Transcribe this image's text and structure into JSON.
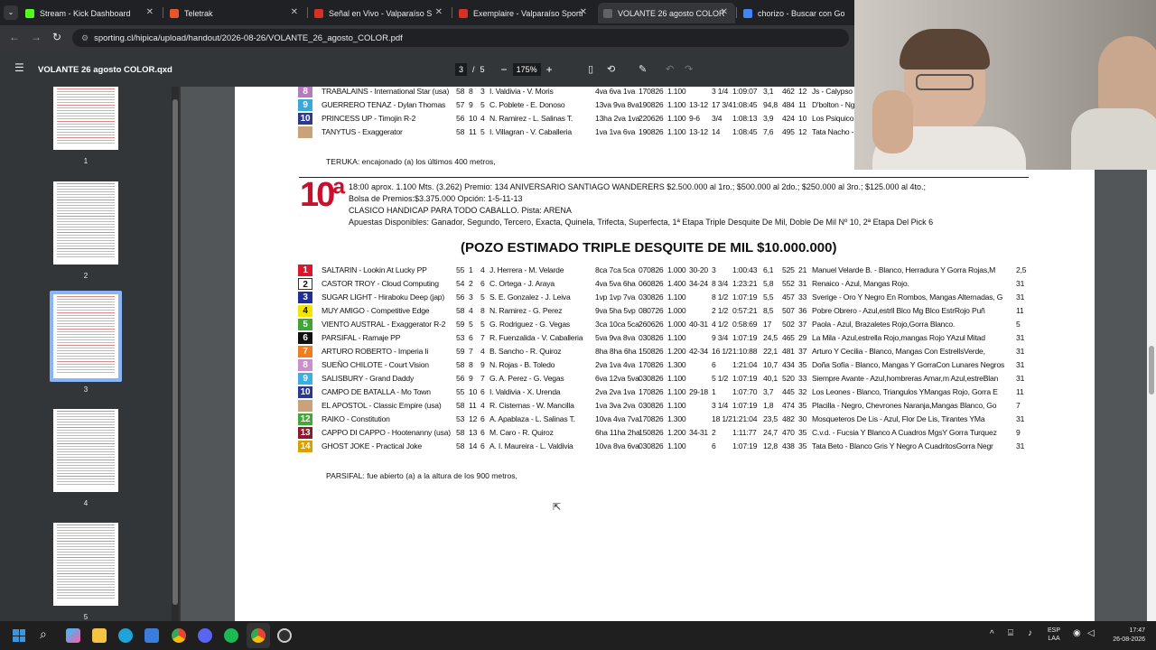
{
  "browser": {
    "tabs": [
      {
        "title": "Stream - Kick Dashboard",
        "active": false,
        "color": "#53fc18"
      },
      {
        "title": "Teletrak",
        "active": false,
        "color": "#e8552b"
      },
      {
        "title": "Señal en Vivo - Valparaíso S",
        "active": false,
        "color": "#d93025"
      },
      {
        "title": "Exemplaire - Valparaíso Sportin",
        "active": false,
        "color": "#d93025"
      },
      {
        "title": "VOLANTE 26 agosto COLOR.qx",
        "active": true,
        "color": "#5f6368"
      },
      {
        "title": "chorizo - Buscar con Google",
        "active": false,
        "color": "#4285f4"
      }
    ],
    "url": "sporting.cl/hipica/upload/handout/2026-08-26/VOLANTE_26_agosto_COLOR.pdf"
  },
  "pdf": {
    "title": "VOLANTE 26 agosto COLOR.qxd",
    "current_page": "3",
    "total_pages": "5",
    "zoom": "175%",
    "thumbnails": [
      "1",
      "2",
      "3",
      "4",
      "5"
    ],
    "selected_thumbnail": "3"
  },
  "prev_race": {
    "rows": [
      {
        "n": "8",
        "c": "#b57bbd",
        "horse": "TRABALAINS - International Star (usa)",
        "w": "58",
        "p": "8",
        "s": "3",
        "jt": "I. Valdivia - V. Moris",
        "form": "4va 6va 1va",
        "date": "170826",
        "dist": "1.100",
        "h": "",
        "m": "3 1/4",
        "time": "1:09:07",
        "a": "3,1",
        "b": "462",
        "d": "12",
        "own": "Js - Calypso"
      },
      {
        "n": "9",
        "c": "#3aa8d8",
        "horse": "GUERRERO TENAZ - Dylan Thomas",
        "w": "57",
        "p": "9",
        "s": "5",
        "jt": "C. Poblete - E. Donoso",
        "form": "13va 9va 8va",
        "date": "190826",
        "dist": "1.100",
        "h": "13-12",
        "m": "17 3/4",
        "time": "1:08:45",
        "a": "94,8",
        "b": "484",
        "d": "11",
        "own": "D'bolton - Ng"
      },
      {
        "n": "10",
        "c": "#2d3a8c",
        "horse": "PRINCESS UP - Timojin R-2",
        "w": "56",
        "p": "10",
        "s": "4",
        "jt": "N. Ramirez - L. Salinas T.",
        "form": "13ha 2va 1va",
        "date": "220626",
        "dist": "1.100",
        "h": "9-6",
        "m": "3/4",
        "time": "1:08:13",
        "a": "3,9",
        "b": "424",
        "d": "10",
        "own": "Los Psiquico"
      },
      {
        "n": "",
        "c": "#c9a27a",
        "horse": "TANYTUS - Exaggerator",
        "w": "58",
        "p": "11",
        "s": "5",
        "jt": "I. Villagran - V. Caballeria",
        "form": "1va 1va 6va",
        "date": "190826",
        "dist": "1.100",
        "h": "13-12",
        "m": "14",
        "time": "1:08:45",
        "a": "7,6",
        "b": "495",
        "d": "12",
        "own": "Tata Nacho -"
      }
    ],
    "note": "TERUKA: encajonado (a) los últimos   400 metros,"
  },
  "race": {
    "number": "10ª",
    "line1": "18:00 aprox. 1.100 Mts. (3.262)   Premio: 134 ANIVERSARIO SANTIAGO WANDERERS    $2.500.000 al 1ro.; $500.000 al 2do.; $250.000 al 3ro.; $125.000 al 4to.;",
    "line2": "Bolsa de Premios:$3.375.000    Opción: 1-5-11-13",
    "line3": "CLASICO HANDICAP  PARA TODO CABALLO.    Pista: ARENA",
    "line4": "Apuestas Disponibles: Ganador, Segundo, Tercero, Exacta, Quinela, Trifecta, Superfecta, 1ª Etapa Triple Desquite De Mil, Doble De Mil Nº 10, 2ª Etapa Del Pick 6",
    "pozo": "(POZO ESTIMADO TRIPLE DESQUITE DE MIL  $10.000.000)",
    "rows": [
      {
        "n": "1",
        "c": "#d7192b",
        "horse": "SALTARIN - Lookin At Lucky  PP",
        "w": "55",
        "p": "1",
        "s": "4",
        "jt": "J. Herrera - M. Velarde",
        "form": "8ca 7ca 5ca",
        "date": "070826",
        "dist": "1.000",
        "h": "30-20",
        "m": "3",
        "time": "1:00:43",
        "a": "6,1",
        "b": "525",
        "d": "21",
        "own": "Manuel Velarde B. - Blanco, Herradura Y Gorra Rojas,M",
        "last": "2,5"
      },
      {
        "n": "2",
        "c": "#ffffff",
        "horse": "CASTOR TROY - Cloud Computing",
        "w": "54",
        "p": "2",
        "s": "6",
        "jt": "C. Ortega - J. Araya",
        "form": "4va 5va 6ha",
        "date": "060826",
        "dist": "1.400",
        "h": "34-24",
        "m": "8 3/4",
        "time": "1:23:21",
        "a": "5,8",
        "b": "552",
        "d": "31",
        "own": "Renaico - Azul, Mangas Rojo.",
        "last": "31"
      },
      {
        "n": "3",
        "c": "#1e2f9a",
        "horse": "SUGAR LIGHT - Hiraboku Deep (jap)",
        "w": "56",
        "p": "3",
        "s": "5",
        "jt": "S. E. Gonzalez - J. Leiva",
        "form": "1vp 1vp 7va",
        "date": "030826",
        "dist": "1.100",
        "h": "",
        "m": "8 1/2",
        "time": "1:07:19",
        "a": "5,5",
        "b": "457",
        "d": "33",
        "own": "Sverige - Oro Y Negro En Rombos, Mangas Alternadas, G",
        "last": "31"
      },
      {
        "n": "4",
        "c": "#f2e600",
        "horse": "MUY AMIGO - Competitive Edge",
        "w": "58",
        "p": "4",
        "s": "8",
        "jt": "N. Ramirez - G. Perez",
        "form": "9va 5ha 5vp",
        "date": "080726",
        "dist": "1.000",
        "h": "",
        "m": "2 1/2",
        "time": "0:57:21",
        "a": "8,5",
        "b": "507",
        "d": "36",
        "own": "Pobre Obrero - Azul,estrll Blco Mg Blco EstrRojo Puñ",
        "last": "11"
      },
      {
        "n": "5",
        "c": "#3fa535",
        "horse": "VIENTO AUSTRAL - Exaggerator R-2",
        "w": "59",
        "p": "5",
        "s": "5",
        "jt": "G. Rodriguez - G. Vegas",
        "form": "3ca 10ca 5ca",
        "date": "260626",
        "dist": "1.000",
        "h": "40-31",
        "m": "4 1/2",
        "time": "0:58:69",
        "a": "17",
        "b": "502",
        "d": "37",
        "own": "Paola - Azul, Brazaletes Rojo,Gorra Blanco.",
        "last": "5"
      },
      {
        "n": "6",
        "c": "#111111",
        "horse": "PARSIFAL - Ramaje  PP",
        "w": "53",
        "p": "6",
        "s": "7",
        "jt": "R. Fuenzalida - V. Caballeria",
        "form": "5va 9va 8va",
        "date": "030826",
        "dist": "1.100",
        "h": "",
        "m": "9 3/4",
        "time": "1:07:19",
        "a": "24,5",
        "b": "465",
        "d": "29",
        "own": "La Mila - Azul,estrella Rojo,mangas Rojo YAzul Mitad",
        "last": "31"
      },
      {
        "n": "7",
        "c": "#ee7d22",
        "horse": "ARTURO ROBERTO - Imperia Ii",
        "w": "59",
        "p": "7",
        "s": "4",
        "jt": "B. Sancho - R. Quiroz",
        "form": "8ha 8ha 6ha",
        "date": "150826",
        "dist": "1.200",
        "h": "42-34",
        "m": "16 1/2",
        "time": "1:10:88",
        "a": "22,1",
        "b": "481",
        "d": "37",
        "own": "Arturo Y Cecilia - Blanco, Mangas Con EstrellsVerde,",
        "last": "31"
      },
      {
        "n": "8",
        "c": "#c990c9",
        "horse": "SUEÑO CHILOTE - Court Vision",
        "w": "58",
        "p": "8",
        "s": "9",
        "jt": "N. Rojas - B. Toledo",
        "form": "2va 1va 4va",
        "date": "170826",
        "dist": "1.300",
        "h": "",
        "m": "6",
        "time": "1:21:04",
        "a": "10,7",
        "b": "434",
        "d": "35",
        "own": "Doña Sofía - Blanco, Mangas Y GorraCon Lunares Negros",
        "last": "31"
      },
      {
        "n": "9",
        "c": "#39b0e0",
        "horse": "SALISBURY - Grand Daddy",
        "w": "56",
        "p": "9",
        "s": "7",
        "jt": "G. A. Perez - G. Vegas",
        "form": "6va 12va 5va",
        "date": "030826",
        "dist": "1.100",
        "h": "",
        "m": "5 1/2",
        "time": "1:07:19",
        "a": "40,1",
        "b": "520",
        "d": "33",
        "own": "Siempre Avante - Azul,hombreras Amar,m Azul,estreBlan",
        "last": "31"
      },
      {
        "n": "10",
        "c": "#2a3890",
        "horse": "CAMPO DE BATALLA - Mo Town",
        "w": "55",
        "p": "10",
        "s": "6",
        "jt": "I. Valdivia - X. Urenda",
        "form": "2va 2va 1va",
        "date": "170826",
        "dist": "1.100",
        "h": "29-18",
        "m": "1",
        "time": "1:07:70",
        "a": "3,7",
        "b": "445",
        "d": "32",
        "own": "Los Leones - Blanco, Triangulos YMangas Rojo, Gorra E",
        "last": "11"
      },
      {
        "n": "",
        "c": "#c9a27a",
        "horse": "EL APOSTOL - Classic Empire (usa)",
        "w": "58",
        "p": "11",
        "s": "4",
        "jt": "R. Cisternas - W. Mancilla",
        "form": "1va 3va 2va",
        "date": "030826",
        "dist": "1.100",
        "h": "",
        "m": "3 1/4",
        "time": "1:07:19",
        "a": "1,8",
        "b": "474",
        "d": "35",
        "own": "Placilla - Negro, Chevrones Naranja,Mangas Blanco, Go",
        "last": "7"
      },
      {
        "n": "12",
        "c": "#46a63a",
        "horse": "RAIKO - Constitution",
        "w": "53",
        "p": "12",
        "s": "6",
        "jt": "A. Apablaza - L. Salinas T.",
        "form": "10va 4va 7va",
        "date": "170826",
        "dist": "1.300",
        "h": "",
        "m": "18 1/2",
        "time": "1:21:04",
        "a": "23,5",
        "b": "482",
        "d": "30",
        "own": "Mosqueteros De Lis - Azul, Flor De Lis,  Tirantes YMa",
        "last": "31"
      },
      {
        "n": "13",
        "c": "#8b1a2e",
        "horse": "CAPPO DI CAPPO - Hootenanny (usa)",
        "w": "58",
        "p": "13",
        "s": "6",
        "jt": "M. Caro - R. Quiroz",
        "form": "6ha 11ha 2ha",
        "date": "150826",
        "dist": "1.200",
        "h": "34-31",
        "m": "2",
        "time": "1:11:77",
        "a": "24,7",
        "b": "470",
        "d": "35",
        "own": "C.v.d. - Fucsia Y Blanco A Cuadros MgsY Gorra Turquez",
        "last": "9"
      },
      {
        "n": "14",
        "c": "#d9a000",
        "horse": "GHOST JOKE - Practical Joke",
        "w": "58",
        "p": "14",
        "s": "6",
        "jt": "A. I. Maureira - L. Valdivia",
        "form": "10va 8va 6va",
        "date": "030826",
        "dist": "1.100",
        "h": "",
        "m": "6",
        "time": "1:07:19",
        "a": "12,8",
        "b": "438",
        "d": "35",
        "own": "Tata Beto - Blanco Gris Y Negro A CuadritosGorra Negr",
        "last": "31"
      }
    ],
    "note": "PARSIFAL: fue abierto (a) a la altura de los 900 metros,"
  },
  "taskbar": {
    "lang1": "ESP",
    "lang2": "LAA",
    "time": "17:47",
    "date": "26-08-2026"
  }
}
